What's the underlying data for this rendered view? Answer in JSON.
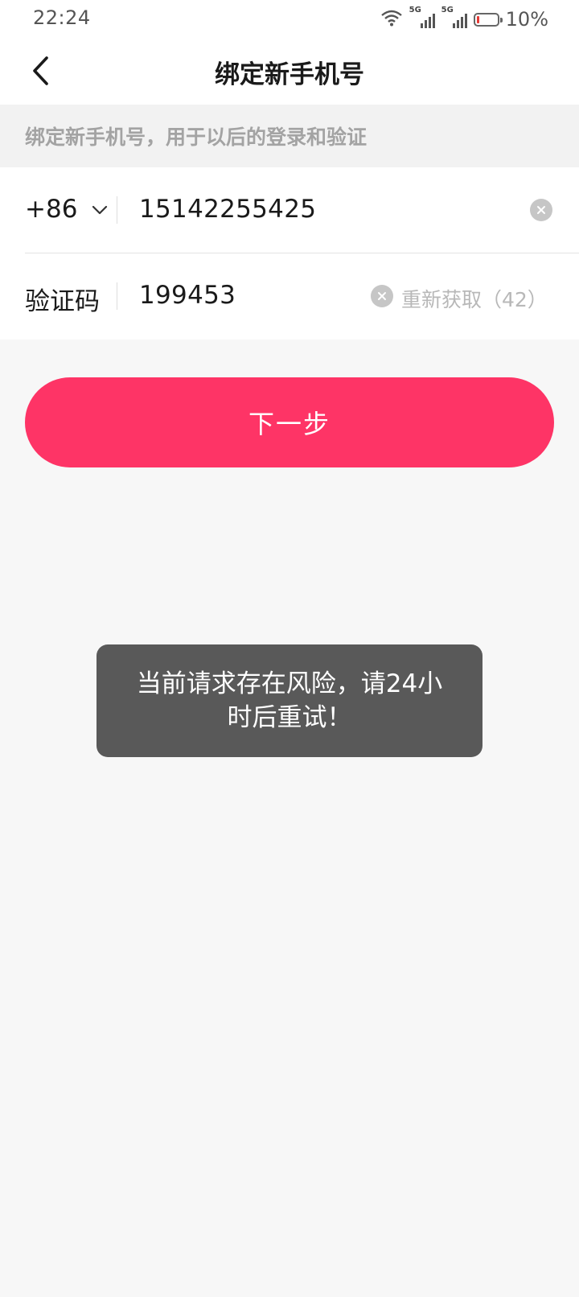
{
  "status_bar": {
    "time": "22:24",
    "network_1": "5G",
    "network_2": "5G",
    "battery_level": 0.1,
    "battery_text": "10%",
    "battery_color": "#e53935"
  },
  "header": {
    "title": "绑定新手机号",
    "back_icon": "chevron-left-icon"
  },
  "hint": {
    "text": "绑定新手机号，用于以后的登录和验证"
  },
  "form": {
    "phone": {
      "country_code": "+86",
      "dropdown_icon": "chevron-down-icon",
      "value": "15142255425",
      "clear_icon": "close-circle-icon"
    },
    "code": {
      "label": "验证码",
      "value": "199453",
      "clear_icon": "close-circle-icon",
      "resend_label": "重新获取（42）"
    }
  },
  "next_button": {
    "label": "下一步",
    "color": "#fe3466"
  },
  "toast": {
    "message": "当前请求存在风险，请24小时后重试！"
  }
}
